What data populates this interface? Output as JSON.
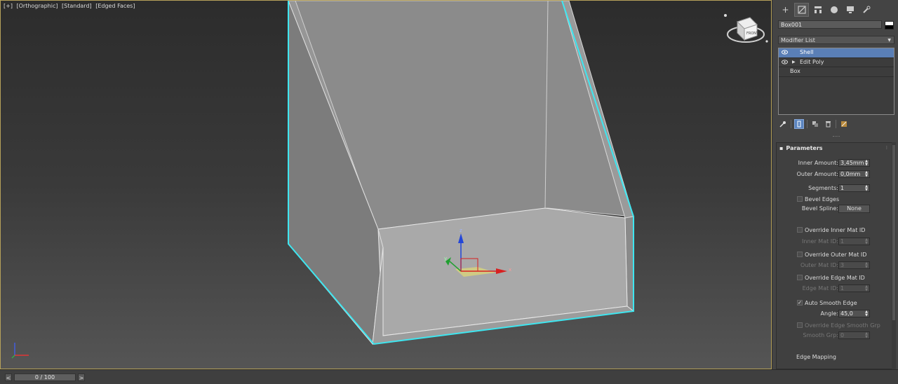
{
  "viewport": {
    "labels": [
      "[+]",
      "[Orthographic]",
      "[Standard]",
      "[Edged Faces]"
    ],
    "viewcube_label": "FRONT",
    "gizmo_axes": {
      "x": "x",
      "y": "y",
      "z": "z"
    },
    "accent_color": "#3ee6f0"
  },
  "timeline": {
    "prev": "<",
    "next": ">",
    "frame": "0 / 100"
  },
  "panel": {
    "object_name": "Box001",
    "modifier_list_label": "Modifier List",
    "stack": [
      {
        "label": "Shell",
        "selected": true,
        "eye": true
      },
      {
        "label": "Edit Poly",
        "selected": false,
        "eye": true,
        "expandable": true
      },
      {
        "label": "Box",
        "selected": false,
        "eye": false
      }
    ],
    "rollout": {
      "title": "Parameters",
      "inner_amount_label": "Inner Amount:",
      "inner_amount_value": "3,45mm",
      "outer_amount_label": "Outer Amount:",
      "outer_amount_value": "0,0mm",
      "segments_label": "Segments:",
      "segments_value": "1",
      "bevel_edges_label": "Bevel Edges",
      "bevel_spline_label": "Bevel Spline:",
      "bevel_spline_value": "None",
      "override_inner_label": "Override Inner Mat ID",
      "inner_mat_label": "Inner Mat ID:",
      "inner_mat_value": "1",
      "override_outer_label": "Override Outer Mat ID",
      "outer_mat_label": "Outer Mat ID:",
      "outer_mat_value": "3",
      "override_edge_label": "Override Edge Mat ID",
      "edge_mat_label": "Edge Mat ID:",
      "edge_mat_value": "1",
      "auto_smooth_label": "Auto Smooth Edge",
      "auto_smooth_checked": true,
      "angle_label": "Angle:",
      "angle_value": "45,0",
      "override_smooth_label": "Override Edge Smooth Grp",
      "smooth_grp_label": "Smooth Grp:",
      "smooth_grp_value": "0",
      "edge_mapping_label": "Edge Mapping"
    }
  }
}
